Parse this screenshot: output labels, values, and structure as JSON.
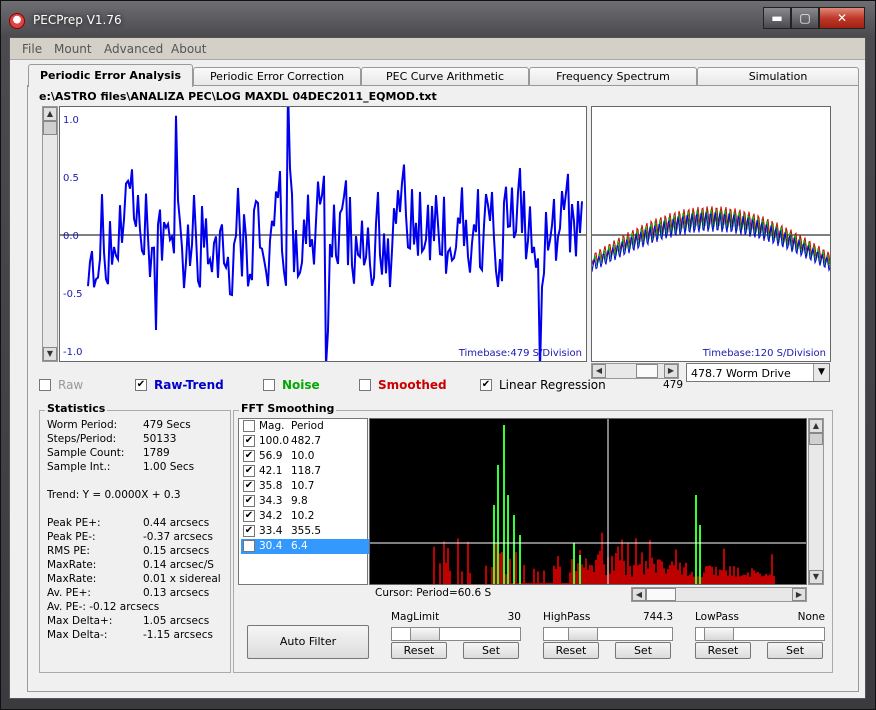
{
  "window": {
    "title": "PECPrep V1.76",
    "min": "▬",
    "max": "▢",
    "close": "✕"
  },
  "menu": [
    "File",
    "Mount",
    "Advanced",
    "About"
  ],
  "tabs": [
    "Periodic Error Analysis",
    "Periodic Error Correction",
    "PEC Curve Arithmetic",
    "Frequency Spectrum",
    "Simulation"
  ],
  "file_path": "e:\\ASTRO files\\ANALIZA PEC\\LOG MAXDL 04DEC2011_EQMOD.txt",
  "main_plot": {
    "y_ticks": [
      "1.0",
      "0.5",
      "0.0",
      "-0.5",
      "-1.0"
    ],
    "timebase": "Timebase:479 S/Division",
    "line_color": "#0000ee"
  },
  "side_plot": {
    "timebase": "Timebase:120 S/Division",
    "scroll_value": "479",
    "dropdown_value": "478.7 Worm Drive",
    "series_colors": [
      "#d00000",
      "#00aa00",
      "#0000dd"
    ]
  },
  "checkboxes": [
    {
      "label": "Raw",
      "checked": false,
      "color": "#999999",
      "bold": false
    },
    {
      "label": "Raw-Trend",
      "checked": true,
      "color": "#0000cc",
      "bold": true
    },
    {
      "label": "Noise",
      "checked": false,
      "color": "#00aa00",
      "bold": true
    },
    {
      "label": "Smoothed",
      "checked": false,
      "color": "#cc0000",
      "bold": true
    },
    {
      "label": "Linear Regression",
      "checked": true,
      "color": "#000000",
      "bold": false
    }
  ],
  "statistics": {
    "title": "Statistics",
    "rows": [
      {
        "label": "Worm Period:",
        "value": "479 Secs"
      },
      {
        "label": "Steps/Period:",
        "value": "50133"
      },
      {
        "label": "Sample Count:",
        "value": "1789"
      },
      {
        "label": "Sample Int.:",
        "value": "1.00 Secs"
      }
    ],
    "trend": "Trend: Y = 0.0000X + 0.3",
    "pe_rows": [
      {
        "label": "Peak PE+:",
        "value": "0.44 arcsecs"
      },
      {
        "label": "Peak PE-:",
        "value": "-0.37 arcsecs"
      },
      {
        "label": "RMS PE:",
        "value": "0.15 arcsecs"
      },
      {
        "label": "MaxRate:",
        "value": "0.14 arcsec/S"
      },
      {
        "label": "MaxRate:",
        "value": "0.01 x sidereal"
      },
      {
        "label": "Av. PE+:",
        "value": "0.13 arcsecs"
      }
    ],
    "av_pe_minus": "Av. PE-:   -0.12 arcsecs",
    "delta_rows": [
      {
        "label": "Max Delta+:",
        "value": "1.05 arcsecs"
      },
      {
        "label": "Max Delta-:",
        "value": "-1.15 arcsecs"
      }
    ]
  },
  "fft": {
    "title": "FFT Smoothing",
    "header": {
      "mag": "Mag.",
      "period": "Period"
    },
    "rows": [
      {
        "mag": "100.0",
        "period": "482.7",
        "checked": true,
        "selected": false
      },
      {
        "mag": "56.9",
        "period": "10.0",
        "checked": true,
        "selected": false
      },
      {
        "mag": "42.1",
        "period": "118.7",
        "checked": true,
        "selected": false
      },
      {
        "mag": "35.8",
        "period": "10.7",
        "checked": true,
        "selected": false
      },
      {
        "mag": "34.3",
        "period": "9.8",
        "checked": true,
        "selected": false
      },
      {
        "mag": "34.2",
        "period": "10.2",
        "checked": true,
        "selected": false
      },
      {
        "mag": "33.4",
        "period": "355.5",
        "checked": true,
        "selected": false
      },
      {
        "mag": "30.4",
        "period": "6.4",
        "checked": true,
        "selected": true
      }
    ],
    "cursor_label": "Cursor: Period=60.6 S",
    "auto_filter": "Auto Filter",
    "controls": [
      {
        "label": "MagLimit",
        "value": "30",
        "reset": "Reset",
        "set": "Set"
      },
      {
        "label": "HighPass",
        "value": "744.3",
        "reset": "Reset",
        "set": "Set"
      },
      {
        "label": "LowPass",
        "value": "None",
        "reset": "Reset",
        "set": "Set"
      }
    ]
  }
}
